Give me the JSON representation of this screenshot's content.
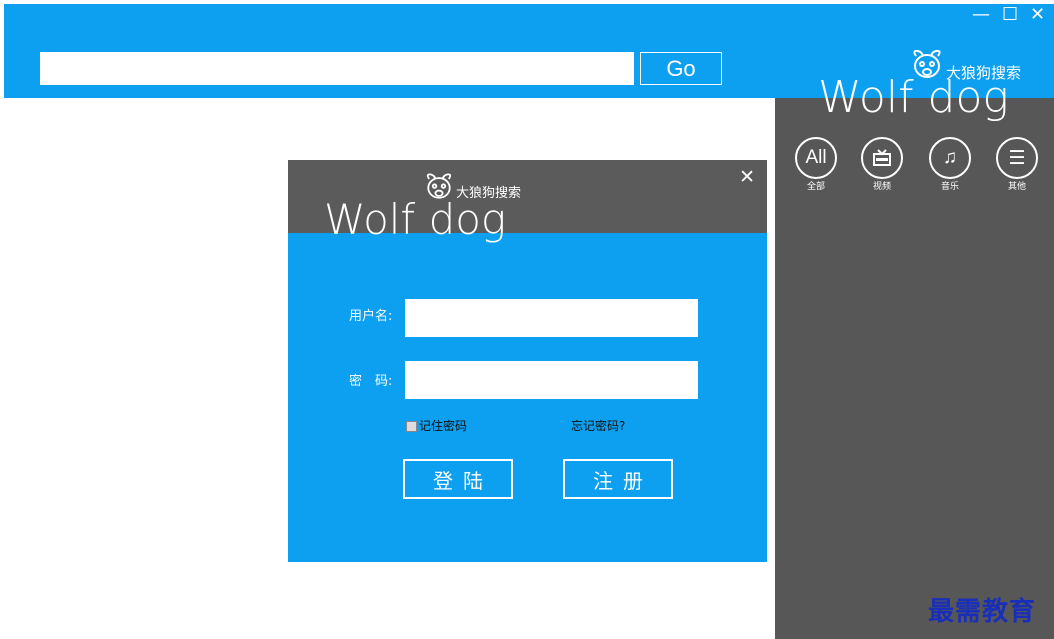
{
  "window": {
    "minimize_glyph": "—",
    "maximize_glyph": "☐",
    "close_glyph": "✕"
  },
  "search": {
    "value": "",
    "placeholder": "",
    "go_label": "Go"
  },
  "brand": {
    "logo_text": "Wolf dog",
    "cn_name": "大狼狗搜索",
    "icon": "dog-head-icon"
  },
  "categories": [
    {
      "icon_text": "All",
      "label": "全部",
      "icon": "all-icon"
    },
    {
      "icon_text": "",
      "label": "视频",
      "icon": "tv-icon"
    },
    {
      "icon_text": "♫",
      "label": "音乐",
      "icon": "music-icon"
    },
    {
      "icon_text": "☰",
      "label": "其他",
      "icon": "list-icon"
    }
  ],
  "login": {
    "close_glyph": "✕",
    "logo_text": "Wolf dog",
    "cn_name": "大狼狗搜索",
    "username_label": "用户名:",
    "username_value": "",
    "password_label": "密　码:",
    "password_value": "",
    "remember_label": "记住密码",
    "remember_checked": false,
    "forgot_label": "忘记密码?",
    "login_button": "登陆",
    "register_button": "注册"
  },
  "watermark": "最需教育",
  "colors": {
    "accent_blue": "#0d9ff0",
    "panel_gray": "#575757",
    "header_gray": "#5b5b5b"
  }
}
